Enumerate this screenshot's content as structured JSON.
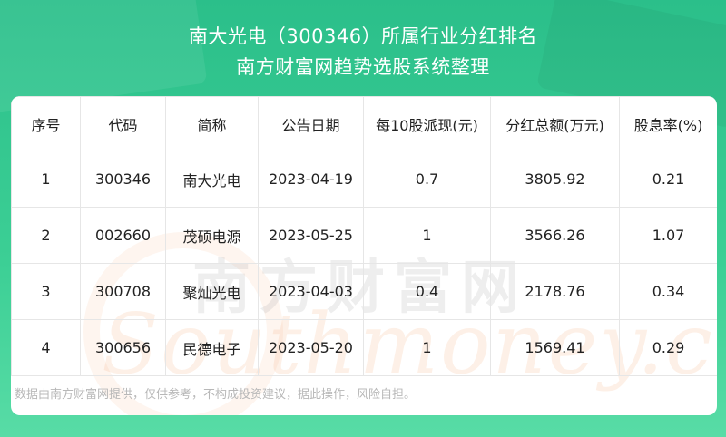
{
  "header": {
    "title_line1": "南大光电（300346）所属行业分红排名",
    "title_line2": "南方财富网趋势选股系统整理"
  },
  "table": {
    "columns": [
      "序号",
      "代码",
      "简称",
      "公告日期",
      "每10股派现(元)",
      "分红总额(万元)",
      "股息率(%)"
    ],
    "rows": [
      [
        "1",
        "300346",
        "南大光电",
        "2023-04-19",
        "0.7",
        "3805.92",
        "0.21"
      ],
      [
        "2",
        "002660",
        "茂硕电源",
        "2023-05-25",
        "1",
        "3566.26",
        "1.07"
      ],
      [
        "3",
        "300708",
        "聚灿光电",
        "2023-04-03",
        "0.4",
        "2178.76",
        "0.34"
      ],
      [
        "4",
        "300656",
        "民德电子",
        "2023-05-20",
        "1",
        "1569.41",
        "0.29"
      ]
    ]
  },
  "watermark": {
    "text_cn": "南方财富网",
    "text_en": "Southmoney.com"
  },
  "footer": {
    "disclaimer": "数据由南方财富网提供，仅供参考，不构成投资建议，据此操作，风险自担。"
  },
  "colors": {
    "header_green": "#3ccf95",
    "text": "#222222",
    "border": "#e6e6e6",
    "footer_text": "#b8b8b8"
  }
}
